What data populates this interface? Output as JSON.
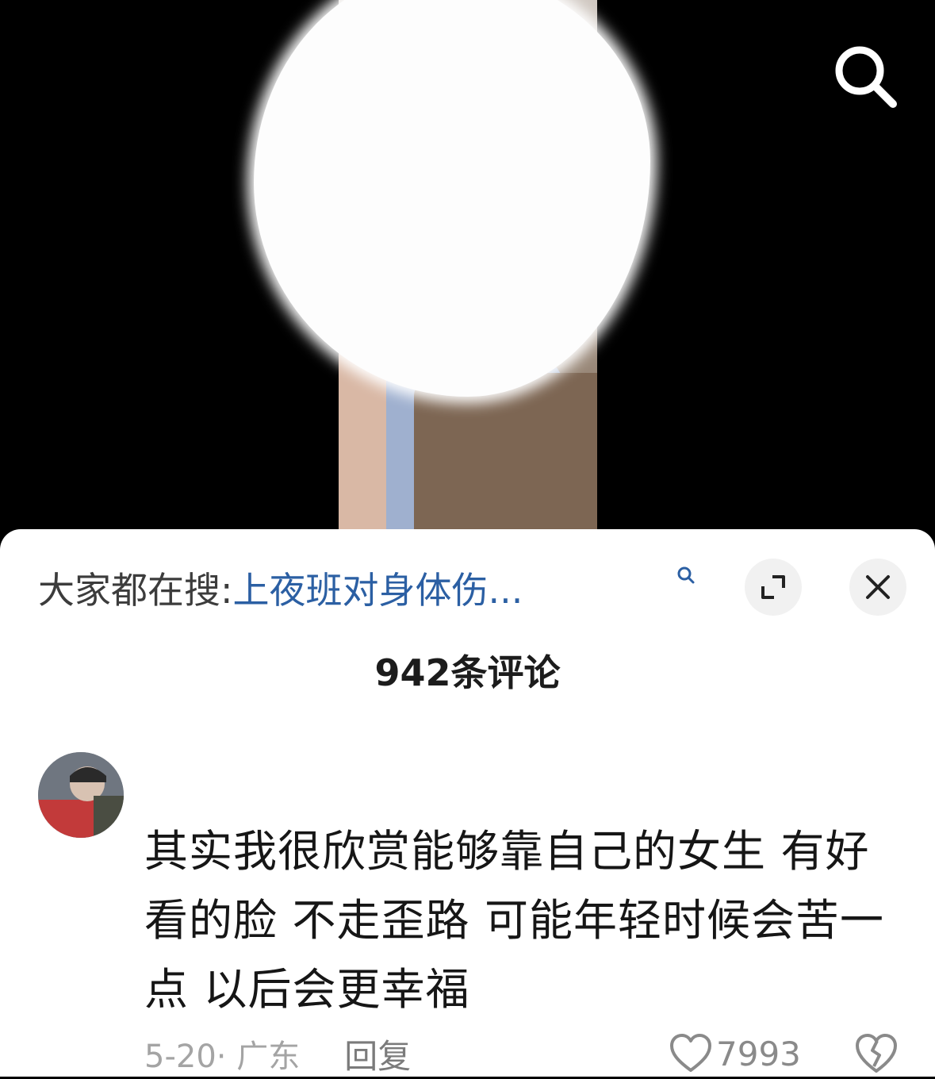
{
  "search_bar": {
    "label": "大家都在搜:",
    "query": "上夜班对身体伤..."
  },
  "comments_header": {
    "count_label": "942条评论"
  },
  "comment": {
    "text": "其实我很欣赏能够靠自己的女生 有好看的脸 不走歪路 可能年轻时候会苦一点 以后会更幸福",
    "date_location": "5-20· 广东",
    "reply_label": "回复",
    "like_count": "7993"
  },
  "colors": {
    "link": "#2b5fa3",
    "sheet_bg": "#ffffff",
    "video_bg": "#000000"
  },
  "icons": [
    "search-icon",
    "expand-icon",
    "close-icon",
    "heart-icon",
    "broken-heart-icon"
  ]
}
